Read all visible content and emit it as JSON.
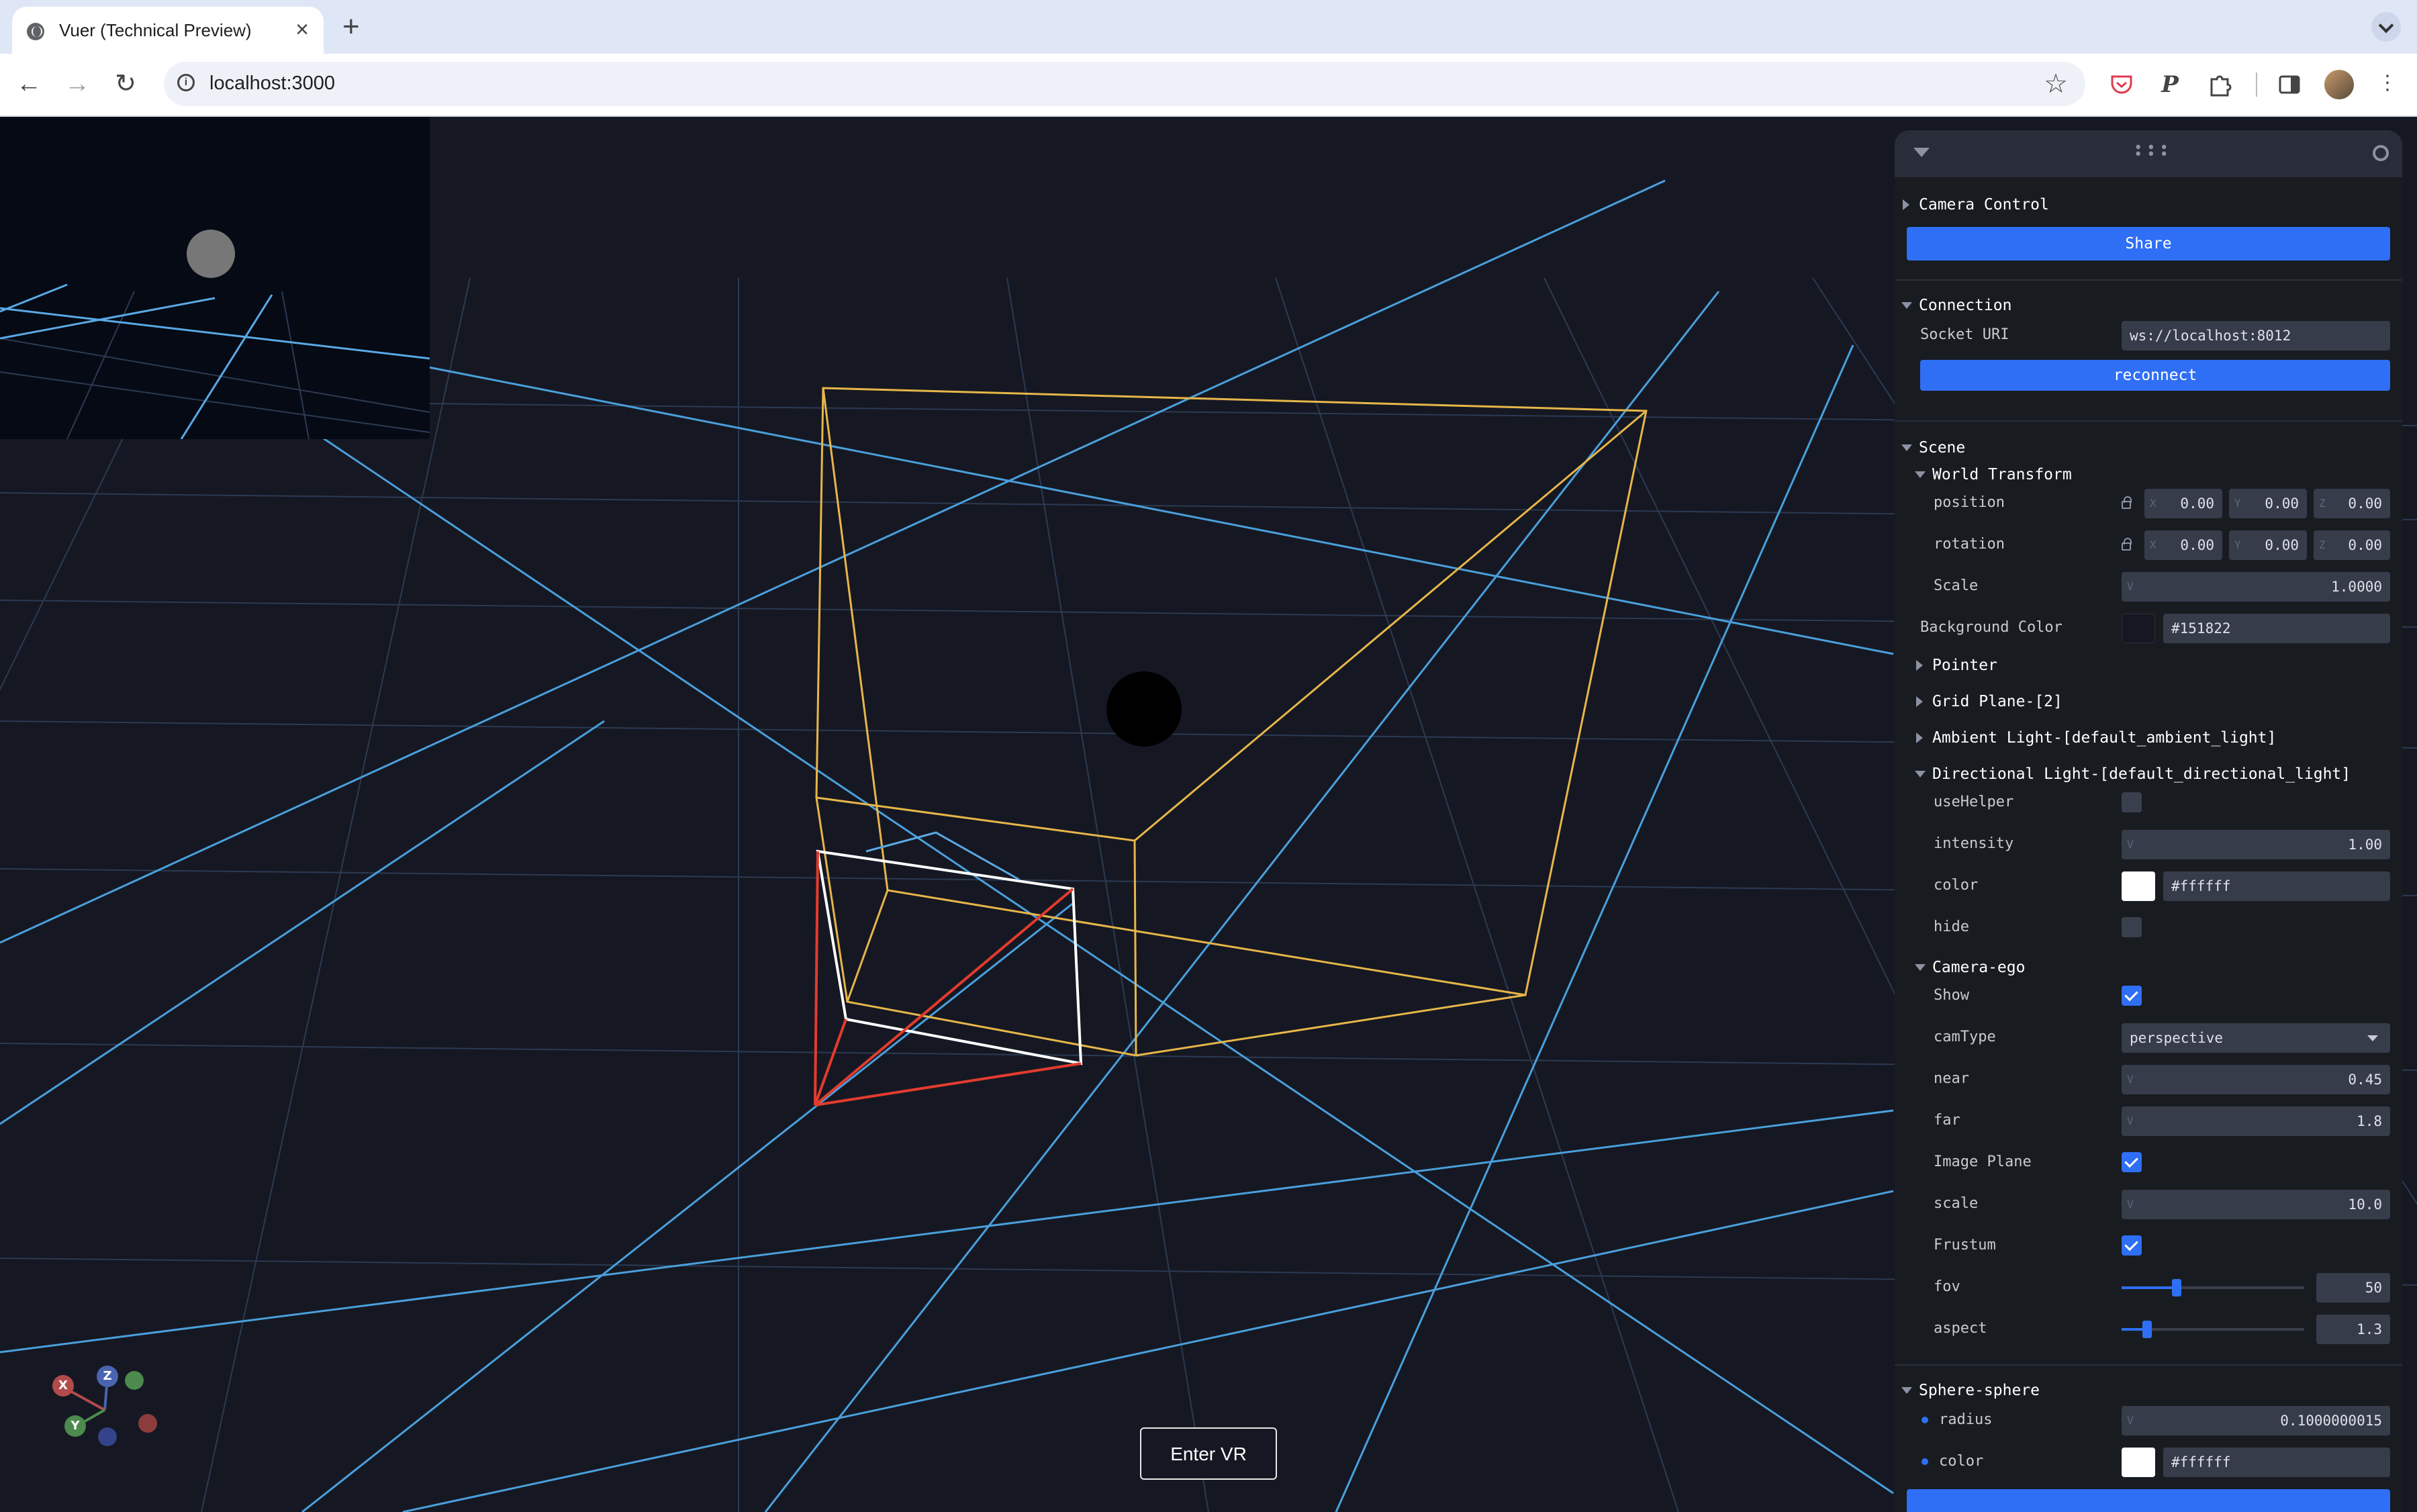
{
  "browser": {
    "tab_title": "Vuer (Technical Preview)",
    "tab_close": "×",
    "new_tab": "+",
    "url": "localhost:3000",
    "icons": [
      "back-icon",
      "forward-icon",
      "reload-icon",
      "site-info-icon",
      "bookmark-star-icon",
      "pocket-icon",
      "p-extension-icon",
      "extensions-puzzle-icon",
      "side-panel-icon",
      "profile-avatar",
      "menu-dots-icon",
      "tab-list-chevron-icon"
    ]
  },
  "viewport": {
    "background_color": "#151822",
    "enter_vr_label": "Enter VR",
    "gizmo": {
      "x": "X",
      "y": "Y",
      "z": "Z"
    },
    "colors": {
      "grid": "#4a9fdc",
      "frustum": "#e7b64a",
      "camera_red": "#e33b2e",
      "image_plane": "#ffffff",
      "sphere_dark": "#000000",
      "sphere_gray": "#777777"
    }
  },
  "panel": {
    "camera_control": {
      "title": "Camera Control",
      "share_label": "Share"
    },
    "connection": {
      "title": "Connection",
      "socket_uri_label": "Socket URI",
      "socket_uri_value": "ws://localhost:8012",
      "reconnect_label": "reconnect"
    },
    "scene": {
      "title": "Scene",
      "world_transform": {
        "title": "World Transform",
        "position_label": "position",
        "position": {
          "x": "0.00",
          "y": "0.00",
          "z": "0.00"
        },
        "rotation_label": "rotation",
        "rotation": {
          "x": "0.00",
          "y": "0.00",
          "z": "0.00"
        },
        "scale_label": "Scale",
        "scale_value": "1.0000",
        "axis_x": "X",
        "axis_y": "Y",
        "axis_z": "Z",
        "axis_v": "V"
      },
      "background_color_label": "Background Color",
      "background_color_value": "#151822",
      "pointer": "Pointer",
      "grid_plane": "Grid Plane-[2]",
      "ambient_light": "Ambient Light-[default_ambient_light]",
      "directional_light": {
        "title": "Directional Light-[default_directional_light]",
        "use_helper_label": "useHelper",
        "use_helper_checked": false,
        "intensity_label": "intensity",
        "intensity_value": "1.00",
        "color_label": "color",
        "color_value": "#ffffff",
        "hide_label": "hide",
        "hide_checked": false
      },
      "camera_ego": {
        "title": "Camera-ego",
        "show_label": "Show",
        "show_checked": true,
        "camtype_label": "camType",
        "camtype_value": "perspective",
        "near_label": "near",
        "near_value": "0.45",
        "far_label": "far",
        "far_value": "1.8",
        "image_plane_label": "Image Plane",
        "image_plane_checked": true,
        "scale_label": "scale",
        "scale_value": "10.0",
        "frustum_label": "Frustum",
        "frustum_checked": true,
        "fov_label": "fov",
        "fov_value": "50",
        "fov_fraction": 0.3,
        "aspect_label": "aspect",
        "aspect_value": "1.3",
        "aspect_fraction": 0.14
      }
    },
    "sphere": {
      "title": "Sphere-sphere",
      "radius_label": "radius",
      "radius_value": "0.1000000015",
      "color_label": "color",
      "color_value": "#ffffff"
    },
    "colors": {
      "accent": "#2f6ff5",
      "panel_bg": "#181c20",
      "field_bg": "#373c4b",
      "header_bg": "#292d39"
    }
  }
}
